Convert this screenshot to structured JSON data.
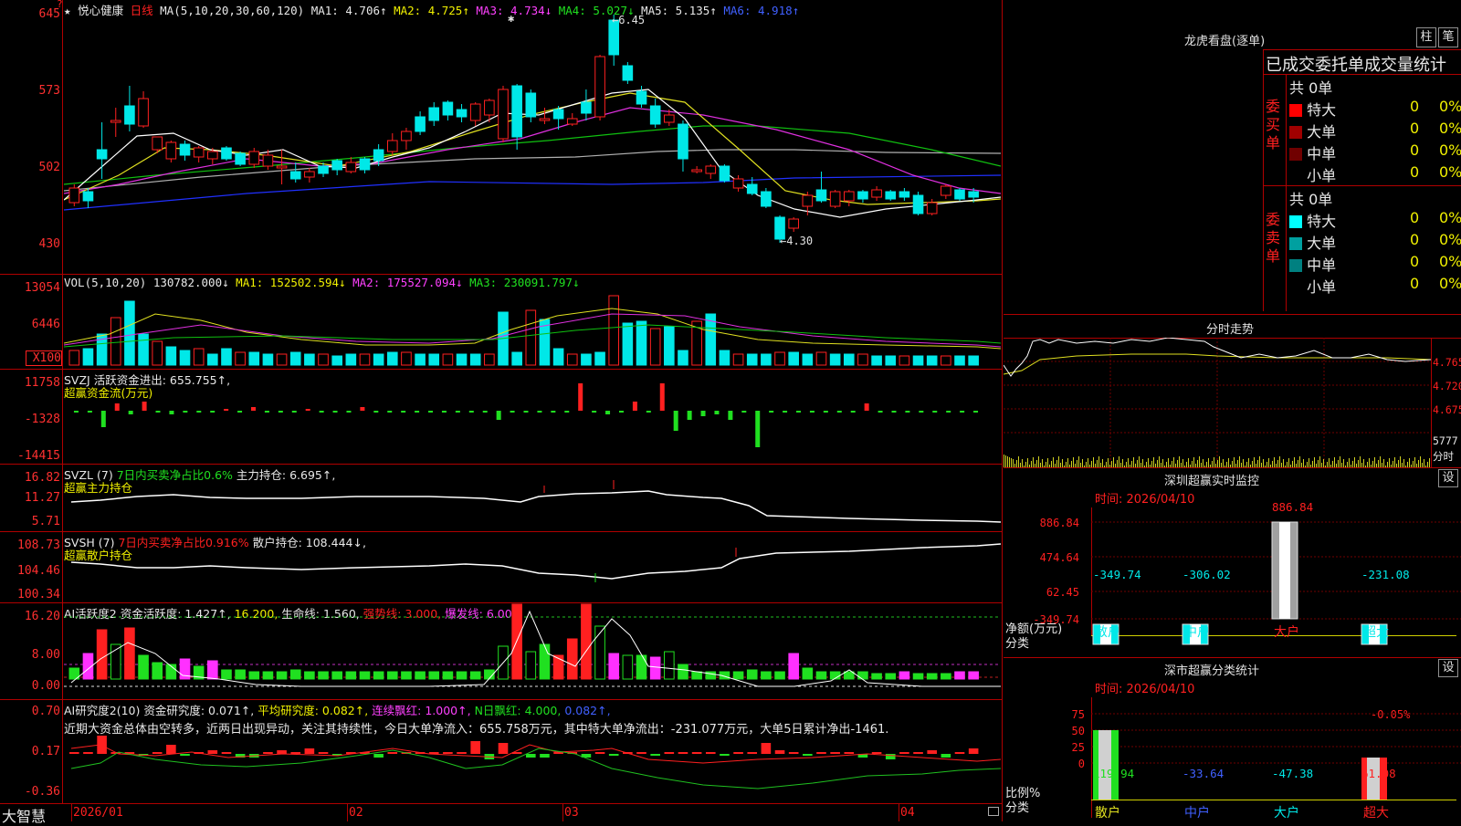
{
  "stock": {
    "star": "★",
    "name": "悦心健康",
    "period": "日线"
  },
  "main_axis": [
    "645",
    "573",
    "502",
    "430"
  ],
  "ma_header": {
    "ma_label": "MA(5,10,20,30,60,120)",
    "ma1": "MA1: 4.706↑",
    "ma2": "MA2: 4.725↑",
    "ma3": "MA3: 4.734↓",
    "ma4": "MA4: 5.027↓",
    "ma5": "MA5: 5.135↑",
    "ma6": "MA6: 4.918↑"
  },
  "price_marks": {
    "high": "6.45",
    "low": "4.30"
  },
  "vol": {
    "axis": [
      "13054",
      "6446",
      "X100"
    ],
    "label": "VOL(5,10,20)",
    "value": "130782.000↓",
    "ma1": "MA1: 152502.594↓",
    "ma2": "MA2: 175527.094↓",
    "ma3": "MA3: 230091.797↓"
  },
  "svzj": {
    "axis": [
      "11758",
      "-1328",
      "-14415"
    ],
    "label": "SVZJ",
    "line": "活跃资金进出: 655.755↑,",
    "sub": "超赢资金流(万元)"
  },
  "svzl": {
    "axis": [
      "16.82",
      "11.27",
      "5.71"
    ],
    "label": "SVZL (7)",
    "pct": "7日内买卖净占比0.6%",
    "hold": "主力持仓: 6.695↑,",
    "sub": "超赢主力持仓"
  },
  "svsh": {
    "axis": [
      "108.73",
      "104.46",
      "100.34"
    ],
    "label": "SVSH (7)",
    "pct": "7日内买卖净占比0.916%",
    "hold": "散户持仓: 108.444↓,",
    "sub": "超赢散户持仓"
  },
  "ai_active": {
    "axis": [
      "16.20",
      "8.00",
      "0.00"
    ],
    "label": "AI活跃度2",
    "a": "资金活跃度: 1.427↑,",
    "b": "16.200,",
    "c": "生命线: 1.560,",
    "d": "强势线: 3.000,",
    "e": "爆发线: 6.000,"
  },
  "ai_research": {
    "axis": [
      "0.70",
      "0.17",
      "-0.36"
    ],
    "label": "AI研究度2(10)",
    "a": "资金研究度: 0.071↑,",
    "b": "平均研究度: 0.082↑,",
    "c": "连续飘红: 1.000↑,",
    "d": "N日飘红: 4.000,",
    "e": "0.082↑,",
    "comment": "近期大资金总体由空转多，近两日出现异动，关注其持续性，今日大单净流入：655.758万元，其中特大单净流出：-231.077万元，大单5日累计净出-1461."
  },
  "xaxis": {
    "brand": "大智慧",
    "labels": [
      "2026/01",
      "02",
      "03",
      "04"
    ]
  },
  "right": {
    "lhb_title": "龙虎看盘(逐单)",
    "btn_zhu": "柱",
    "btn_bi": "笔",
    "table_title": "已成交委托单成交量统计",
    "buy_side": "委买单",
    "sell_side": "委卖单",
    "buy_total": "共 0单",
    "sell_total": "共 0单",
    "rows_buy": [
      {
        "label": "特大",
        "count": "0",
        "pct": "0%",
        "color": "#ff0000"
      },
      {
        "label": "大单",
        "count": "0",
        "pct": "0%",
        "color": "#a00000"
      },
      {
        "label": "中单",
        "count": "0",
        "pct": "0%",
        "color": "#700000"
      },
      {
        "label": "小单",
        "count": "0",
        "pct": "0%",
        "color": ""
      }
    ],
    "rows_sell": [
      {
        "label": "特大",
        "count": "0",
        "pct": "0%",
        "color": "#00ffff"
      },
      {
        "label": "大单",
        "count": "0",
        "pct": "0%",
        "color": "#00a0a0"
      },
      {
        "label": "中单",
        "count": "0",
        "pct": "0%",
        "color": "#008080"
      },
      {
        "label": "小单",
        "count": "0",
        "pct": "0%",
        "color": ""
      }
    ],
    "fenshi_title": "分时走势",
    "fenshi_axis": [
      "4.765",
      "4.720",
      "4.675"
    ],
    "fenshi_vol": [
      "5777",
      "分时"
    ],
    "monitor_title": "深圳超赢实时监控",
    "monitor_btn": "设",
    "monitor_time": "时间: 2026/04/10",
    "monitor_axis": [
      "886.84",
      "474.64",
      "62.45",
      "-349.74"
    ],
    "monitor_axis_label": [
      "净额(万元)",
      "分类"
    ],
    "monitor_vals": [
      "-349.74",
      "-306.02",
      "886.84",
      "-231.08"
    ],
    "monitor_cats": [
      "散户",
      "中户",
      "大户",
      "超大"
    ],
    "stat_title": "深市超赢分类统计",
    "stat_btn": "设",
    "stat_time": "时间: 2026/04/10",
    "stat_axis": [
      "75",
      "50",
      "25",
      "0"
    ],
    "stat_axis_label": [
      "比例%",
      "分类"
    ],
    "stat_top": "-0.05%",
    "stat_vals": [
      "119.94",
      "-33.64",
      "-47.38",
      "61.08"
    ],
    "stat_cats": [
      "散户",
      "中户",
      "大户",
      "超大"
    ]
  }
}
